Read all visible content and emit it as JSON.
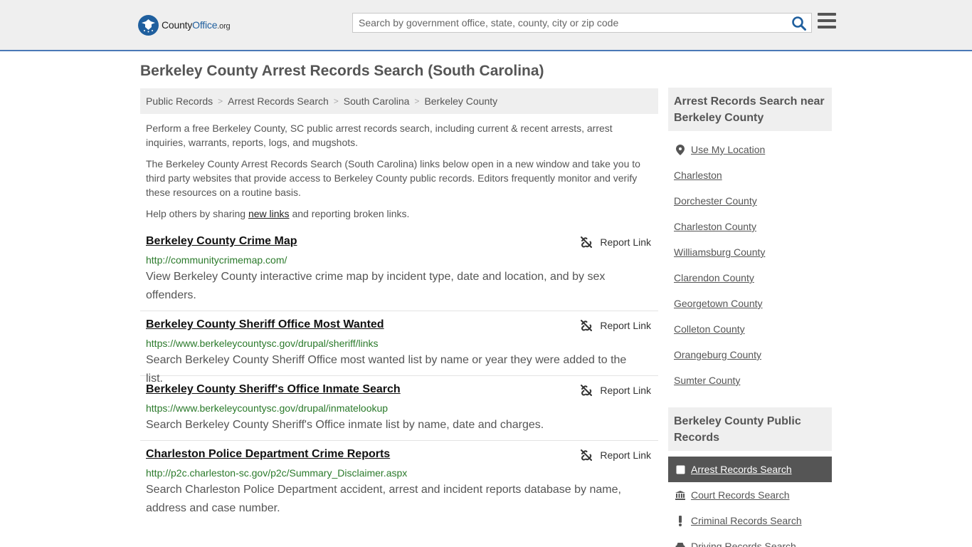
{
  "header": {
    "logo_text_main": "County",
    "logo_text_accent": "Office",
    "logo_text_suffix": ".org",
    "search_placeholder": "Search by government office, state, county, city or zip code"
  },
  "page_title": "Berkeley County Arrest Records Search (South Carolina)",
  "breadcrumb": [
    "Public Records",
    "Arrest Records Search",
    "South Carolina",
    "Berkeley County"
  ],
  "intro": {
    "p1": "Perform a free Berkeley County, SC public arrest records search, including current & recent arrests, arrest inquiries, warrants, reports, logs, and mugshots.",
    "p2": "The Berkeley County Arrest Records Search (South Carolina) links below open in a new window and take you to third party websites that provide access to Berkeley County public records. Editors frequently monitor and verify these resources on a routine basis.",
    "p3_before": "Help others by sharing ",
    "p3_link": "new links",
    "p3_after": " and reporting broken links."
  },
  "report_label": "Report Link",
  "results": [
    {
      "title": "Berkeley County Crime Map",
      "url": "http://communitycrimemap.com/",
      "desc": "View Berkeley County interactive crime map by incident type, date and location, and by sex offenders."
    },
    {
      "title": "Berkeley County Sheriff Office Most Wanted",
      "url": "https://www.berkeleycountysc.gov/drupal/sheriff/links",
      "desc": "Search Berkeley County Sheriff Office most wanted list by name or year they were added to the list."
    },
    {
      "title": "Berkeley County Sheriff's Office Inmate Search",
      "url": "https://www.berkeleycountysc.gov/drupal/inmatelookup",
      "desc": "Search Berkeley County Sheriff's Office inmate list by name, date and charges."
    },
    {
      "title": "Charleston Police Department Crime Reports",
      "url": "http://p2c.charleston-sc.gov/p2c/Summary_Disclaimer.aspx",
      "desc": "Search Charleston Police Department accident, arrest and incident reports database by name, address and case number."
    }
  ],
  "sidebar": {
    "nearby_heading": "Arrest Records Search near Berkeley County",
    "use_location": "Use My Location",
    "nearby": [
      "Charleston",
      "Dorchester County",
      "Charleston County",
      "Williamsburg County",
      "Clarendon County",
      "Georgetown County",
      "Colleton County",
      "Orangeburg County",
      "Sumter County"
    ],
    "public_heading": "Berkeley County Public Records",
    "public": [
      {
        "label": "Arrest Records Search",
        "icon": "square-icon",
        "active": true
      },
      {
        "label": "Court Records Search",
        "icon": "courthouse-icon",
        "active": false
      },
      {
        "label": "Criminal Records Search",
        "icon": "exclamation-icon",
        "active": false
      },
      {
        "label": "Driving Records Search",
        "icon": "car-icon",
        "active": false
      }
    ]
  },
  "colors": {
    "accent": "#4a78b6",
    "url_green": "#2b7a2b",
    "header_bg": "#efefef",
    "active_bg": "#555555"
  }
}
